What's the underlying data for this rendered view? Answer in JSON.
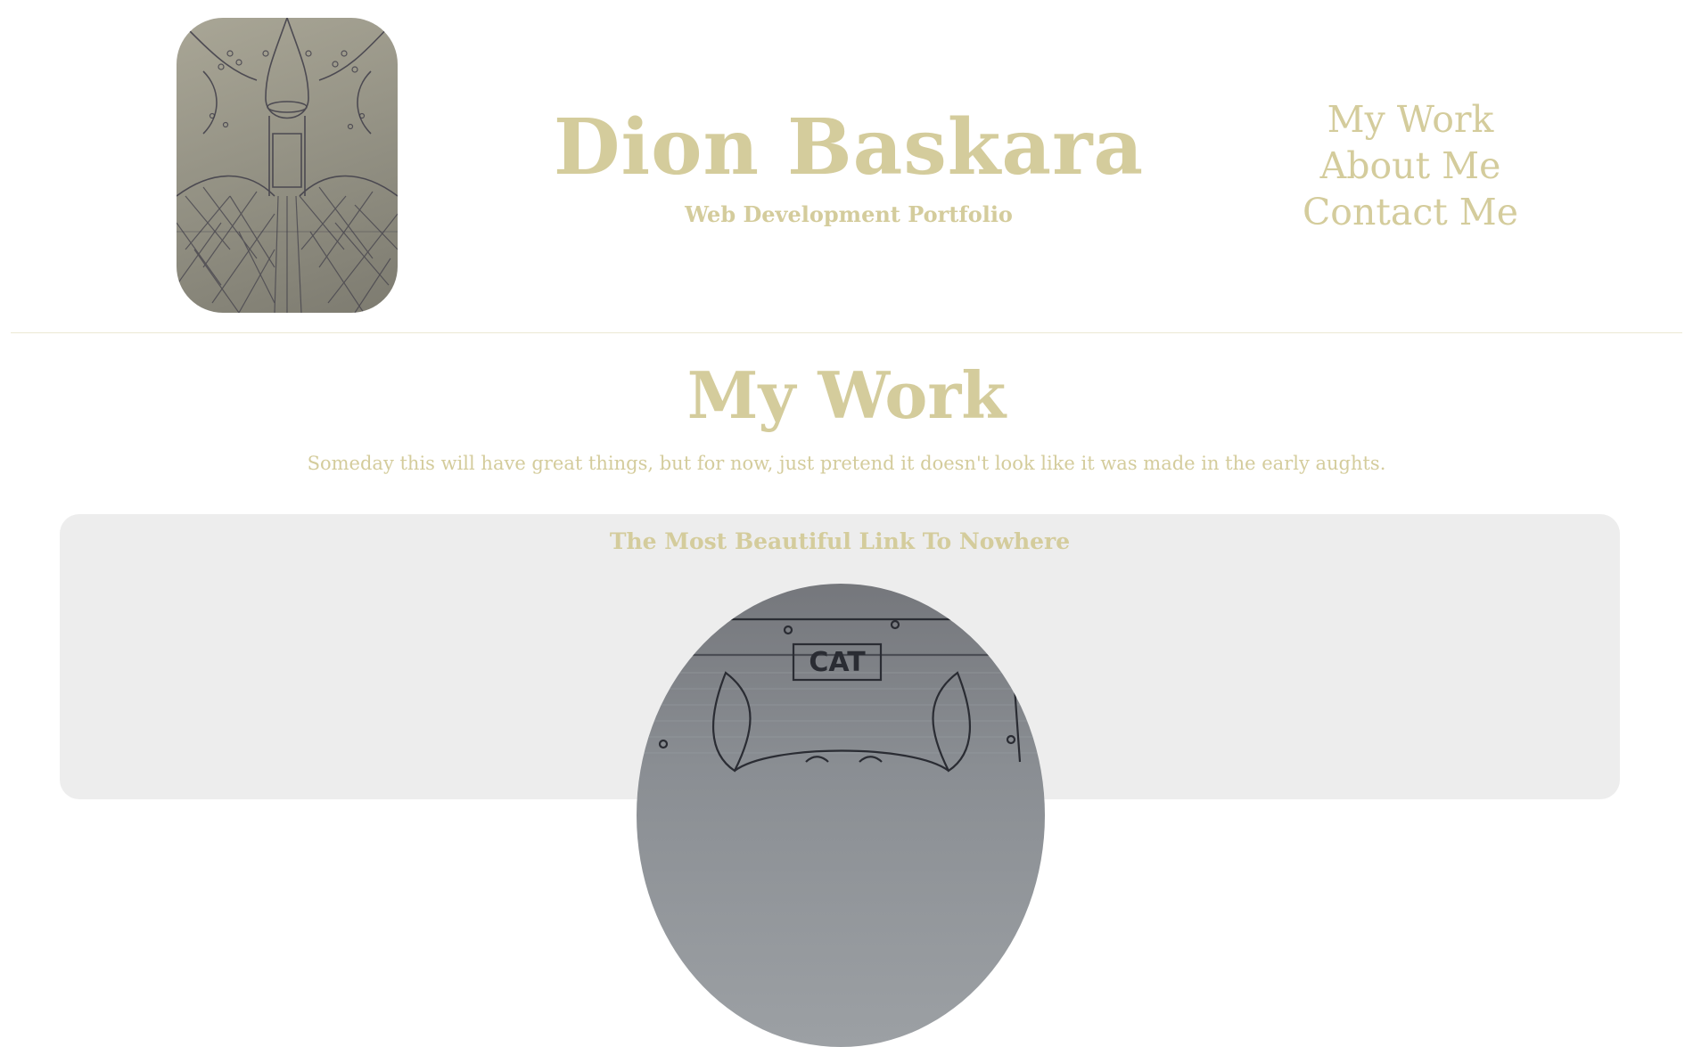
{
  "header": {
    "title": "Dion Baskara",
    "subtitle": "Web Development Portfolio"
  },
  "nav": {
    "items": [
      "My Work",
      "About Me",
      "Contact Me"
    ]
  },
  "main": {
    "heading": "My Work",
    "tagline": "Someday this will have great things, but for now, just pretend it doesn't look like it was made in the early aughts.",
    "card": {
      "title": "The Most Beautiful Link To Nowhere",
      "sign_text": "CAT"
    }
  },
  "colors": {
    "accent": "#d4cc9c",
    "card_bg": "#ededed",
    "divider": "#ece8d4"
  }
}
